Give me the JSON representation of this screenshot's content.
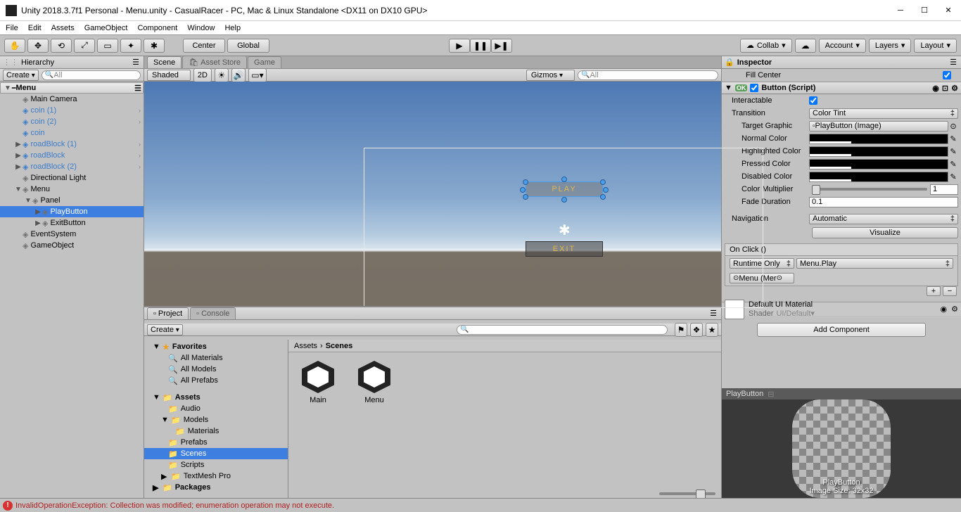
{
  "window": {
    "title": "Unity 2018.3.7f1 Personal - Menu.unity - CasualRacer - PC, Mac & Linux Standalone <DX11 on DX10 GPU>"
  },
  "menubar": [
    "File",
    "Edit",
    "Assets",
    "GameObject",
    "Component",
    "Window",
    "Help"
  ],
  "toolbar": {
    "center": "Center",
    "global": "Global",
    "collab": "Collab",
    "account": "Account",
    "layers": "Layers",
    "layout": "Layout"
  },
  "hierarchy": {
    "title": "Hierarchy",
    "create": "Create",
    "search": "All",
    "scene": "Menu",
    "items": [
      {
        "label": "Main Camera",
        "depth": 1,
        "icon": "gray"
      },
      {
        "label": "coin (1)",
        "depth": 1,
        "icon": "blue",
        "expand": true,
        "chev": true
      },
      {
        "label": "coin (2)",
        "depth": 1,
        "icon": "blue",
        "expand": true,
        "chev": true
      },
      {
        "label": "coin",
        "depth": 1,
        "icon": "blue",
        "expand": true
      },
      {
        "label": "roadBlock (1)",
        "depth": 1,
        "icon": "blue",
        "fold": "▶",
        "chev": true
      },
      {
        "label": "roadBlock",
        "depth": 1,
        "icon": "blue",
        "fold": "▶",
        "chev": true
      },
      {
        "label": "roadBlock (2)",
        "depth": 1,
        "icon": "blue",
        "fold": "▶",
        "chev": true
      },
      {
        "label": "Directional Light",
        "depth": 1,
        "icon": "gray"
      },
      {
        "label": "Menu",
        "depth": 1,
        "icon": "gray",
        "fold": "▼"
      },
      {
        "label": "Panel",
        "depth": 2,
        "icon": "gray",
        "fold": "▼"
      },
      {
        "label": "PlayButton",
        "depth": 3,
        "icon": "gray",
        "fold": "▶",
        "sel": true
      },
      {
        "label": "ExitButton",
        "depth": 3,
        "icon": "gray",
        "fold": "▶"
      },
      {
        "label": "EventSystem",
        "depth": 1,
        "icon": "gray"
      },
      {
        "label": "GameObject",
        "depth": 1,
        "icon": "gray"
      }
    ]
  },
  "scene": {
    "tabs": [
      "Scene",
      "Asset Store",
      "Game"
    ],
    "shaded": "Shaded",
    "mode2d": "2D",
    "gizmos": "Gizmos",
    "search": "All",
    "play_label": "PLAY",
    "exit_label": "EXIT"
  },
  "project": {
    "tabs": [
      "Project",
      "Console"
    ],
    "create": "Create",
    "favorites": "Favorites",
    "fav_items": [
      "All Materials",
      "All Models",
      "All Prefabs"
    ],
    "assets": "Assets",
    "folders": [
      "Audio",
      "Models",
      "Materials",
      "Prefabs",
      "Scenes",
      "Scripts",
      "TextMesh Pro"
    ],
    "packages": "Packages",
    "breadcrumb": [
      "Assets",
      "Scenes"
    ],
    "grid": [
      "Main",
      "Menu"
    ]
  },
  "inspector": {
    "title": "Inspector",
    "fillcenter": "Fill Center",
    "component": "Button (Script)",
    "interactable": "Interactable",
    "transition": "Transition",
    "transition_val": "Color Tint",
    "target_graphic": "Target Graphic",
    "target_val": "PlayButton (Image)",
    "normal": "Normal Color",
    "highlighted": "Highlighted Color",
    "pressed": "Pressed Color",
    "disabled": "Disabled Color",
    "multiplier": "Color Multiplier",
    "multiplier_val": "1",
    "fade": "Fade Duration",
    "fade_val": "0.1",
    "navigation": "Navigation",
    "navigation_val": "Automatic",
    "visualize": "Visualize",
    "onclick": "On Click ()",
    "runtime": "Runtime Only",
    "func": "Menu.Play",
    "obj": "Menu (Mer",
    "material": "Default UI Material",
    "shader_label": "Shader",
    "shader_val": "UI/Default",
    "add_component": "Add Component",
    "preview_name": "PlayButton",
    "preview_caption1": "PlayButton",
    "preview_caption2": "Image Size: 32x32"
  },
  "status": {
    "error": "InvalidOperationException: Collection was modified; enumeration operation may not execute."
  }
}
